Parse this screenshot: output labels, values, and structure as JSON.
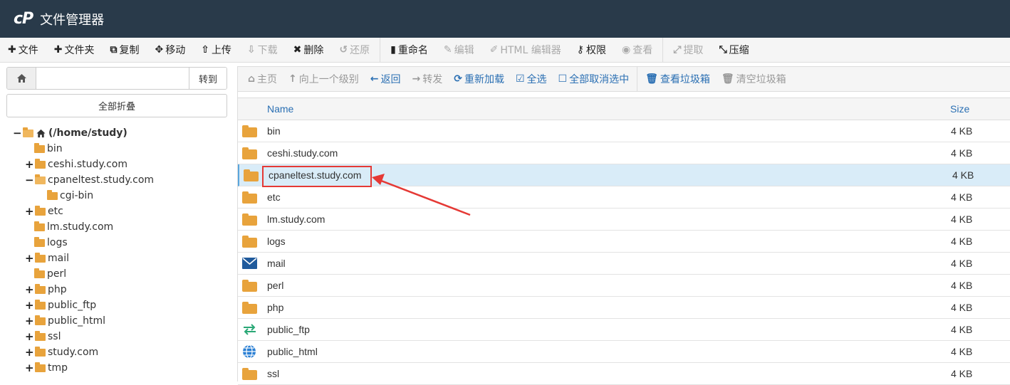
{
  "app": {
    "logo": "cP",
    "title": "文件管理器"
  },
  "toolbar": {
    "items": [
      {
        "label": "文件",
        "icon": "plus-icon",
        "enabled": true
      },
      {
        "label": "文件夹",
        "icon": "plus-icon",
        "enabled": true
      },
      {
        "label": "复制",
        "icon": "copy-icon",
        "enabled": true
      },
      {
        "label": "移动",
        "icon": "move-icon",
        "enabled": true
      },
      {
        "label": "上传",
        "icon": "upload-icon",
        "enabled": true
      },
      {
        "label": "下载",
        "icon": "download-icon",
        "enabled": false
      },
      {
        "label": "删除",
        "icon": "times-icon",
        "enabled": true
      },
      {
        "label": "还原",
        "icon": "undo-icon",
        "enabled": false
      },
      {
        "label": "重命名",
        "icon": "file-icon",
        "enabled": true
      },
      {
        "label": "编辑",
        "icon": "pencil-icon",
        "enabled": false
      },
      {
        "label": "HTML 编辑器",
        "icon": "edit-icon",
        "enabled": false
      },
      {
        "label": "权限",
        "icon": "key-icon",
        "enabled": true
      },
      {
        "label": "查看",
        "icon": "eye-icon",
        "enabled": false
      },
      {
        "label": "提取",
        "icon": "expand-icon",
        "enabled": false
      },
      {
        "label": "压缩",
        "icon": "compress-icon",
        "enabled": true
      }
    ]
  },
  "left": {
    "path_placeholder": "",
    "go_label": "转到",
    "collapse_label": "全部折叠",
    "tree": [
      {
        "label": "(/home/study)",
        "toggle": "−",
        "open": true,
        "root": true
      },
      {
        "label": "bin",
        "toggle": "",
        "open": false
      },
      {
        "label": "ceshi.study.com",
        "toggle": "+",
        "open": false
      },
      {
        "label": "cpaneltest.study.com",
        "toggle": "−",
        "open": true
      },
      {
        "label": "cgi-bin",
        "toggle": "",
        "open": false
      },
      {
        "label": "etc",
        "toggle": "+",
        "open": false
      },
      {
        "label": "lm.study.com",
        "toggle": "",
        "open": false
      },
      {
        "label": "logs",
        "toggle": "",
        "open": false
      },
      {
        "label": "mail",
        "toggle": "+",
        "open": false
      },
      {
        "label": "perl",
        "toggle": "",
        "open": false
      },
      {
        "label": "php",
        "toggle": "+",
        "open": false
      },
      {
        "label": "public_ftp",
        "toggle": "+",
        "open": false
      },
      {
        "label": "public_html",
        "toggle": "+",
        "open": false
      },
      {
        "label": "ssl",
        "toggle": "+",
        "open": false
      },
      {
        "label": "study.com",
        "toggle": "+",
        "open": false
      },
      {
        "label": "tmp",
        "toggle": "+",
        "open": false
      }
    ]
  },
  "nav": {
    "items": [
      {
        "label": "主页",
        "icon": "home-icon",
        "state": "disabled"
      },
      {
        "label": "向上一个级别",
        "icon": "level-up-icon",
        "state": "disabled"
      },
      {
        "label": "返回",
        "icon": "arrow-left-icon",
        "state": "active"
      },
      {
        "label": "转发",
        "icon": "arrow-right-icon",
        "state": "disabled"
      },
      {
        "label": "重新加载",
        "icon": "refresh-icon",
        "state": "active"
      },
      {
        "label": "全选",
        "icon": "check-square-icon",
        "state": "active"
      },
      {
        "label": "全部取消选中",
        "icon": "square-icon",
        "state": "active"
      },
      {
        "label": "查看垃圾箱",
        "icon": "trash-icon",
        "state": "active"
      },
      {
        "label": "清空垃圾箱",
        "icon": "trash-icon",
        "state": "disabled"
      }
    ]
  },
  "table": {
    "col_name": "Name",
    "col_size": "Size",
    "rows": [
      {
        "name": "bin",
        "size": "4 KB",
        "type": "folder"
      },
      {
        "name": "ceshi.study.com",
        "size": "4 KB",
        "type": "folder"
      },
      {
        "name": "cpaneltest.study.com",
        "size": "4 KB",
        "type": "folder",
        "selected": true
      },
      {
        "name": "etc",
        "size": "4 KB",
        "type": "folder"
      },
      {
        "name": "lm.study.com",
        "size": "4 KB",
        "type": "folder"
      },
      {
        "name": "logs",
        "size": "4 KB",
        "type": "folder"
      },
      {
        "name": "mail",
        "size": "4 KB",
        "type": "mail"
      },
      {
        "name": "perl",
        "size": "4 KB",
        "type": "folder"
      },
      {
        "name": "php",
        "size": "4 KB",
        "type": "folder"
      },
      {
        "name": "public_ftp",
        "size": "4 KB",
        "type": "ftp"
      },
      {
        "name": "public_html",
        "size": "4 KB",
        "type": "globe"
      },
      {
        "name": "ssl",
        "size": "4 KB",
        "type": "folder"
      }
    ]
  },
  "colors": {
    "header_bg": "#293a4a",
    "folder": "#e8a33c",
    "link_blue": "#2a6fb3",
    "selected_row": "#d9ecf8",
    "annotation_red": "#e53935"
  }
}
